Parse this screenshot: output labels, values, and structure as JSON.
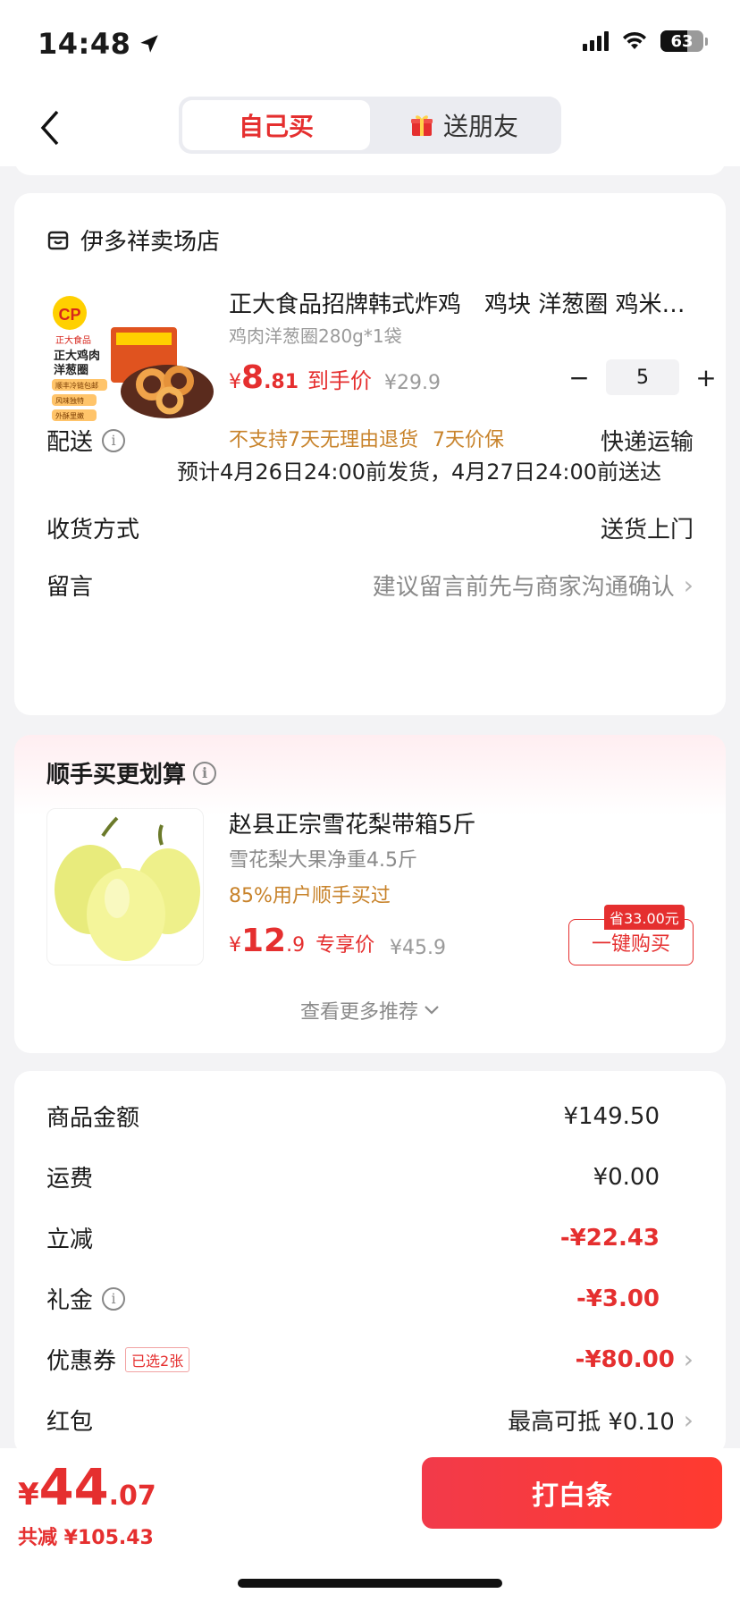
{
  "status": {
    "time": "14:48",
    "battery": "63"
  },
  "nav": {
    "tab_self": "自己买",
    "tab_gift": "送朋友"
  },
  "order": {
    "shop_name": "伊多祥卖场店",
    "product_title": "正大食品招牌韩式炸鸡　鸡块 洋葱圈 鸡米…",
    "product_sku": "鸡肉洋葱圈280g*1袋",
    "price_symbol": "¥",
    "price_int": "8",
    "price_dec": ".81",
    "price_tag": "到手价",
    "orig_price": "¥29.9",
    "quantity": "5",
    "policy_1": "不支持7天无理由退货",
    "policy_2": "7天价保",
    "product_image_text": {
      "brand": "CP",
      "brand_cn": "正大食品",
      "line1": "正大鸡肉",
      "line2": "洋葱圈",
      "tag1": "顺丰冷链包邮",
      "tag2": "风味独特",
      "tag3": "外酥里嫩"
    },
    "delivery_label": "配送",
    "delivery_value": "快递运输",
    "delivery_note": "预计4月26日24:00前发货，4月27日24:00前送达",
    "receive_label": "收货方式",
    "receive_value": "送货上门",
    "message_label": "留言",
    "message_hint": "建议留言前先与商家沟通确认"
  },
  "recommend": {
    "title": "顺手买更划算",
    "name": "赵县正宗雪花梨带箱5斤",
    "sub": "雪花梨大果净重4.5斤",
    "popularity": "85%用户顺手买过",
    "price_symbol": "¥",
    "price_int": "12",
    "price_dec": ".9",
    "price_tag": "专享价",
    "orig_price": "¥45.9",
    "save_badge": "省33.00元",
    "buy_label": "一键购买",
    "more_label": "查看更多推荐"
  },
  "summary": {
    "goods_label": "商品金额",
    "goods_value": "¥149.50",
    "shipping_label": "运费",
    "shipping_value": "¥0.00",
    "discount_label": "立减",
    "discount_value": "-¥22.43",
    "gift_label": "礼金",
    "gift_value": "-¥3.00",
    "coupon_label": "优惠券",
    "coupon_tag": "已选2张",
    "coupon_value": "-¥80.00",
    "redpacket_label": "红包",
    "redpacket_value": "最高可抵 ¥0.10"
  },
  "bottom": {
    "total_symbol": "¥",
    "total_int": "44",
    "total_dec": ".07",
    "total_saving": "共减 ¥105.43",
    "pay_label": "打白条"
  },
  "colors": {
    "accent": "#e52f2f",
    "policy": "#c8832b",
    "background": "#f3f3f5"
  }
}
